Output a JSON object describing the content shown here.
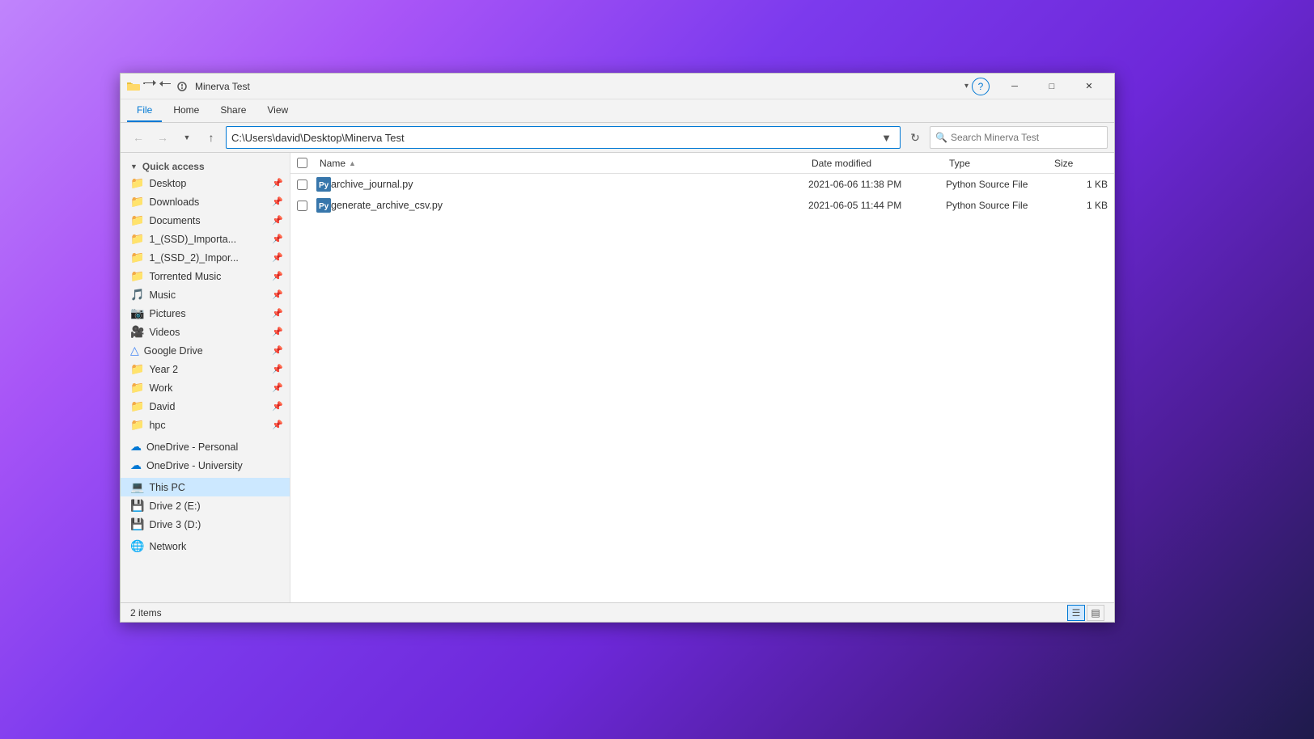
{
  "window": {
    "title": "Minerva Test",
    "address": "C:\\Users\\david\\Desktop\\Minerva Test",
    "search_placeholder": "Search Minerva Test"
  },
  "ribbon": {
    "tabs": [
      "File",
      "Home",
      "Share",
      "View"
    ],
    "active_tab": "File"
  },
  "nav": {
    "back": "←",
    "forward": "→",
    "up": "↑",
    "recent": "▾",
    "refresh": "⟳"
  },
  "columns": {
    "checkbox": "",
    "name": "Name",
    "date_modified": "Date modified",
    "type": "Type",
    "size": "Size"
  },
  "files": [
    {
      "name": "archive_journal.py",
      "date_modified": "2021-06-06 11:38 PM",
      "type": "Python Source File",
      "size": "1 KB"
    },
    {
      "name": "generate_archive_csv.py",
      "date_modified": "2021-06-05 11:44 PM",
      "type": "Python Source File",
      "size": "1 KB"
    }
  ],
  "sidebar": {
    "quick_access_label": "Quick access",
    "items_quick": [
      {
        "label": "Desktop",
        "icon": "folder",
        "pinned": true
      },
      {
        "label": "Downloads",
        "icon": "folder_down",
        "pinned": true
      },
      {
        "label": "Documents",
        "icon": "folder_doc",
        "pinned": true
      },
      {
        "label": "1_(SSD)_Importa...",
        "icon": "folder_yellow",
        "pinned": true
      },
      {
        "label": "1_(SSD_2)_Impor...",
        "icon": "folder_yellow",
        "pinned": true
      },
      {
        "label": "Torrented Music",
        "icon": "folder_yellow",
        "pinned": true
      },
      {
        "label": "Music",
        "icon": "music",
        "pinned": true
      },
      {
        "label": "Pictures",
        "icon": "pictures",
        "pinned": true
      },
      {
        "label": "Videos",
        "icon": "videos",
        "pinned": true
      },
      {
        "label": "Google Drive",
        "icon": "gdrive",
        "pinned": true
      },
      {
        "label": "Year 2",
        "icon": "folder_yellow",
        "pinned": true
      },
      {
        "label": "Work",
        "icon": "folder_yellow",
        "pinned": true
      },
      {
        "label": "David",
        "icon": "folder_yellow",
        "pinned": true
      },
      {
        "label": "hpc",
        "icon": "folder_yellow",
        "pinned": true
      }
    ],
    "items_cloud": [
      {
        "label": "OneDrive - Personal",
        "icon": "onedrive"
      },
      {
        "label": "OneDrive - University",
        "icon": "onedrive"
      }
    ],
    "items_devices": [
      {
        "label": "This PC",
        "icon": "thispc",
        "selected": true
      },
      {
        "label": "Drive 2 (E:)",
        "icon": "drive"
      },
      {
        "label": "Drive 3 (D:)",
        "icon": "drive"
      }
    ],
    "items_network": [
      {
        "label": "Network",
        "icon": "network"
      }
    ]
  },
  "status": {
    "item_count": "2 items"
  },
  "view_buttons": {
    "list": "☰",
    "details": "▤"
  }
}
